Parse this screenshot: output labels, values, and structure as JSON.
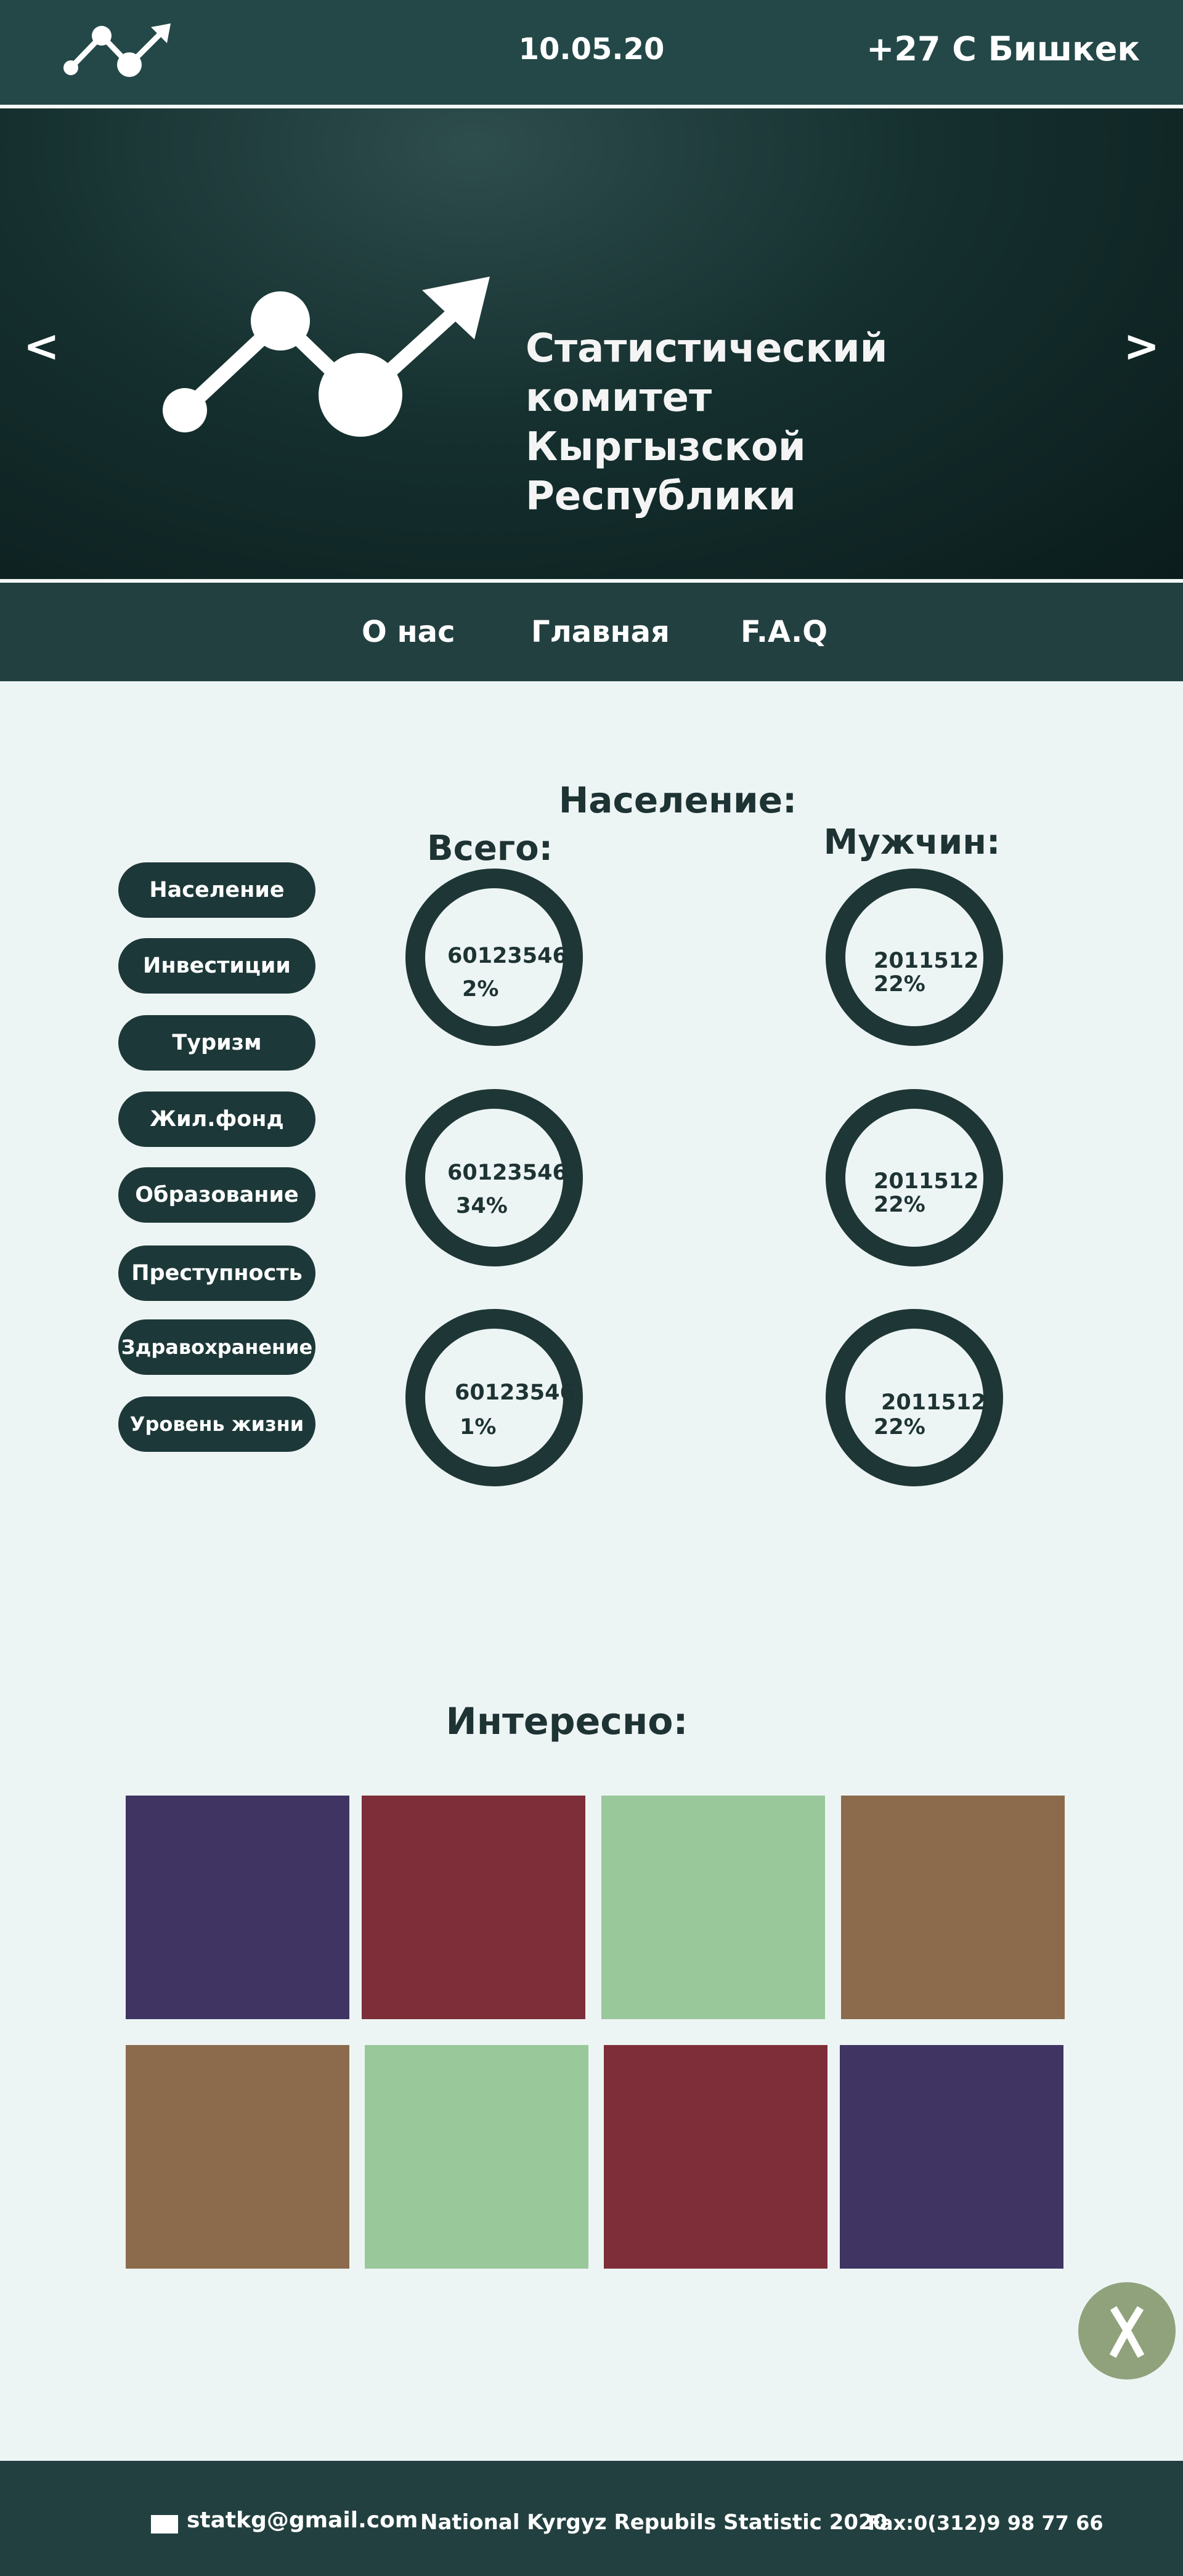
{
  "header": {
    "date": "10.05.20",
    "weather": "+27 С Бишкек",
    "logo_icon": "stats-up-icon"
  },
  "hero": {
    "title_line1": "Статистический комитет",
    "title_line2": "Кыргызской Республики",
    "prev_label": "<",
    "next_label": ">",
    "slides": 3,
    "active_slide": 2
  },
  "nav": {
    "items": [
      "О нас",
      "Главная",
      "F.A.Q"
    ]
  },
  "population": {
    "title": "Население:",
    "col_total": "Всего:",
    "col_male": "Мужчин:",
    "sidebar": [
      "Население",
      "Инвестиции",
      "Туризм",
      "Жил.фонд",
      "Образование",
      "Преступность",
      "Здравохранение",
      "Уровень жизни"
    ],
    "total": [
      {
        "value": "60123546",
        "percent": "2%"
      },
      {
        "value": "60123546",
        "percent": "34%"
      },
      {
        "value": "60123546",
        "percent": "1%"
      }
    ],
    "male": [
      {
        "value": "2011512",
        "percent": "22%"
      },
      {
        "value": "2011512",
        "percent": "22%"
      },
      {
        "value": "2011512",
        "percent": "22%"
      }
    ]
  },
  "interesting": {
    "title": "Интересно:",
    "tiles_row1": [
      "#3f3462",
      "#7d2e38",
      "#99c89a",
      "#8b6b4c"
    ],
    "tiles_row2": [
      "#8b6b4c",
      "#99c89a",
      "#7d2e38",
      "#3f3462"
    ]
  },
  "footer": {
    "email": "statkg@gmail.com",
    "copyright": "National Kyrgyz Repubils Statistic 2020",
    "fax": "Fax:0(312)9 98 77 66"
  },
  "colors": {
    "header_bg": "#244848",
    "hero_bg": "#0b1c1c",
    "accent_dark": "#1e3636",
    "page_bg": "#edf5f4",
    "fab": "#8fa27c"
  }
}
